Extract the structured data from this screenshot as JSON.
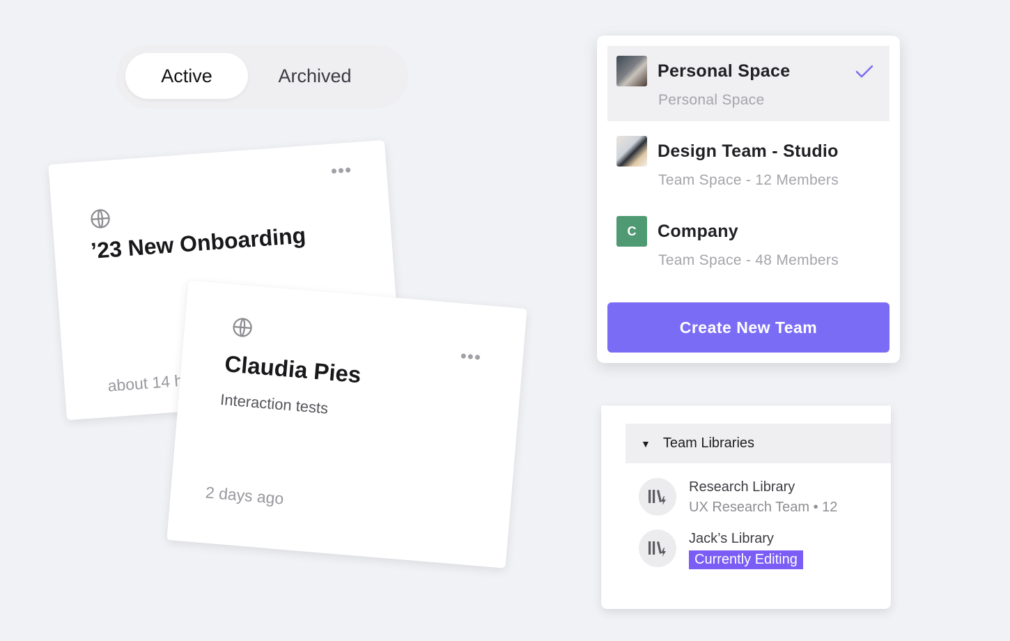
{
  "tabs": [
    {
      "label": "Active",
      "active": true
    },
    {
      "label": "Archived",
      "active": false
    }
  ],
  "cards": [
    {
      "title": "’23 New Onboarding",
      "subtitle": "",
      "time": "about 14 h",
      "icon": "globe-icon"
    },
    {
      "title": "Claudia Pies",
      "subtitle": "Interaction tests",
      "time": "2 days ago",
      "icon": "globe-icon"
    }
  ],
  "menu_icon": "•••",
  "workspaces": {
    "items": [
      {
        "name": "Personal Space",
        "subtitle": "Personal Space",
        "avatar": "photo",
        "selected": true
      },
      {
        "name": "Design Team - Studio",
        "subtitle": "Team Space - 12 Members",
        "avatar": "photo",
        "selected": false
      },
      {
        "name": "Company",
        "subtitle": "Team Space - 48 Members",
        "avatar_letter": "C",
        "avatar_color": "#4f9a72",
        "selected": false
      }
    ],
    "check_color": "#7b6cf6",
    "create_button": "Create New Team",
    "accent": "#7b6cf6"
  },
  "libraries": {
    "header": "Team Libraries",
    "caret": "▼",
    "items": [
      {
        "name": "Research Library",
        "subtitle": "UX Research Team • 12",
        "icon": "library-icon"
      },
      {
        "name": "Jack’s Library",
        "badge": "Currently Editing",
        "icon": "library-icon"
      }
    ],
    "badge_color": "#7b5cf5"
  }
}
